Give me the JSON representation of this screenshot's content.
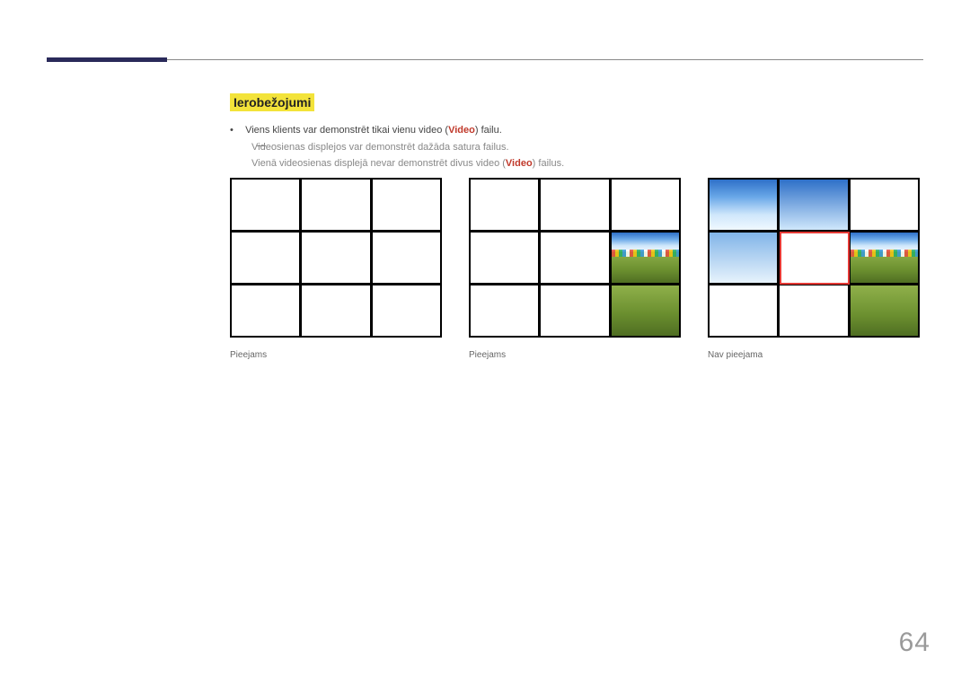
{
  "section_title": "Ierobežojumi",
  "bullet": {
    "line1_pre": "Viens klients var demonstrēt tikai vienu video (",
    "line1_mid": "Video",
    "line1_post": ") failu.",
    "sub1": "Videosienas displejos var demonstrēt dažāda satura failus.",
    "sub2_pre": "Vienā videosienas displejā nevar demonstrēt divus video (",
    "sub2_mid": "Video",
    "sub2_post": ") failus."
  },
  "examples": {
    "a": {
      "caption": "Pieejams"
    },
    "b": {
      "caption": "Pieejams"
    },
    "c": {
      "caption": "Nav pieejama"
    }
  },
  "page_number": "64"
}
